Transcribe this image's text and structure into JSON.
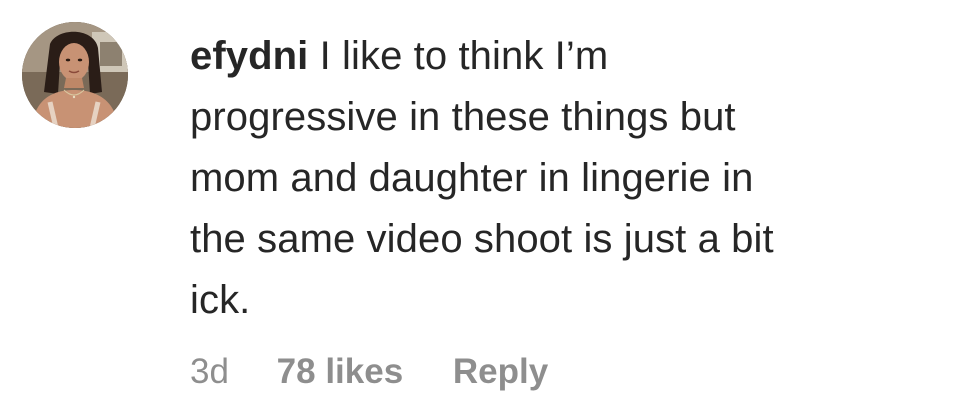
{
  "comment": {
    "username": "efydni",
    "text_lines": [
      "I like to think I’m",
      "progressive in these things but",
      "mom and daughter in lingerie in",
      "the same video shoot is just a bit",
      "ick."
    ],
    "time": "3d",
    "likes": "78 likes",
    "reply_label": "Reply",
    "avatar_icon": "user-avatar-photo"
  }
}
